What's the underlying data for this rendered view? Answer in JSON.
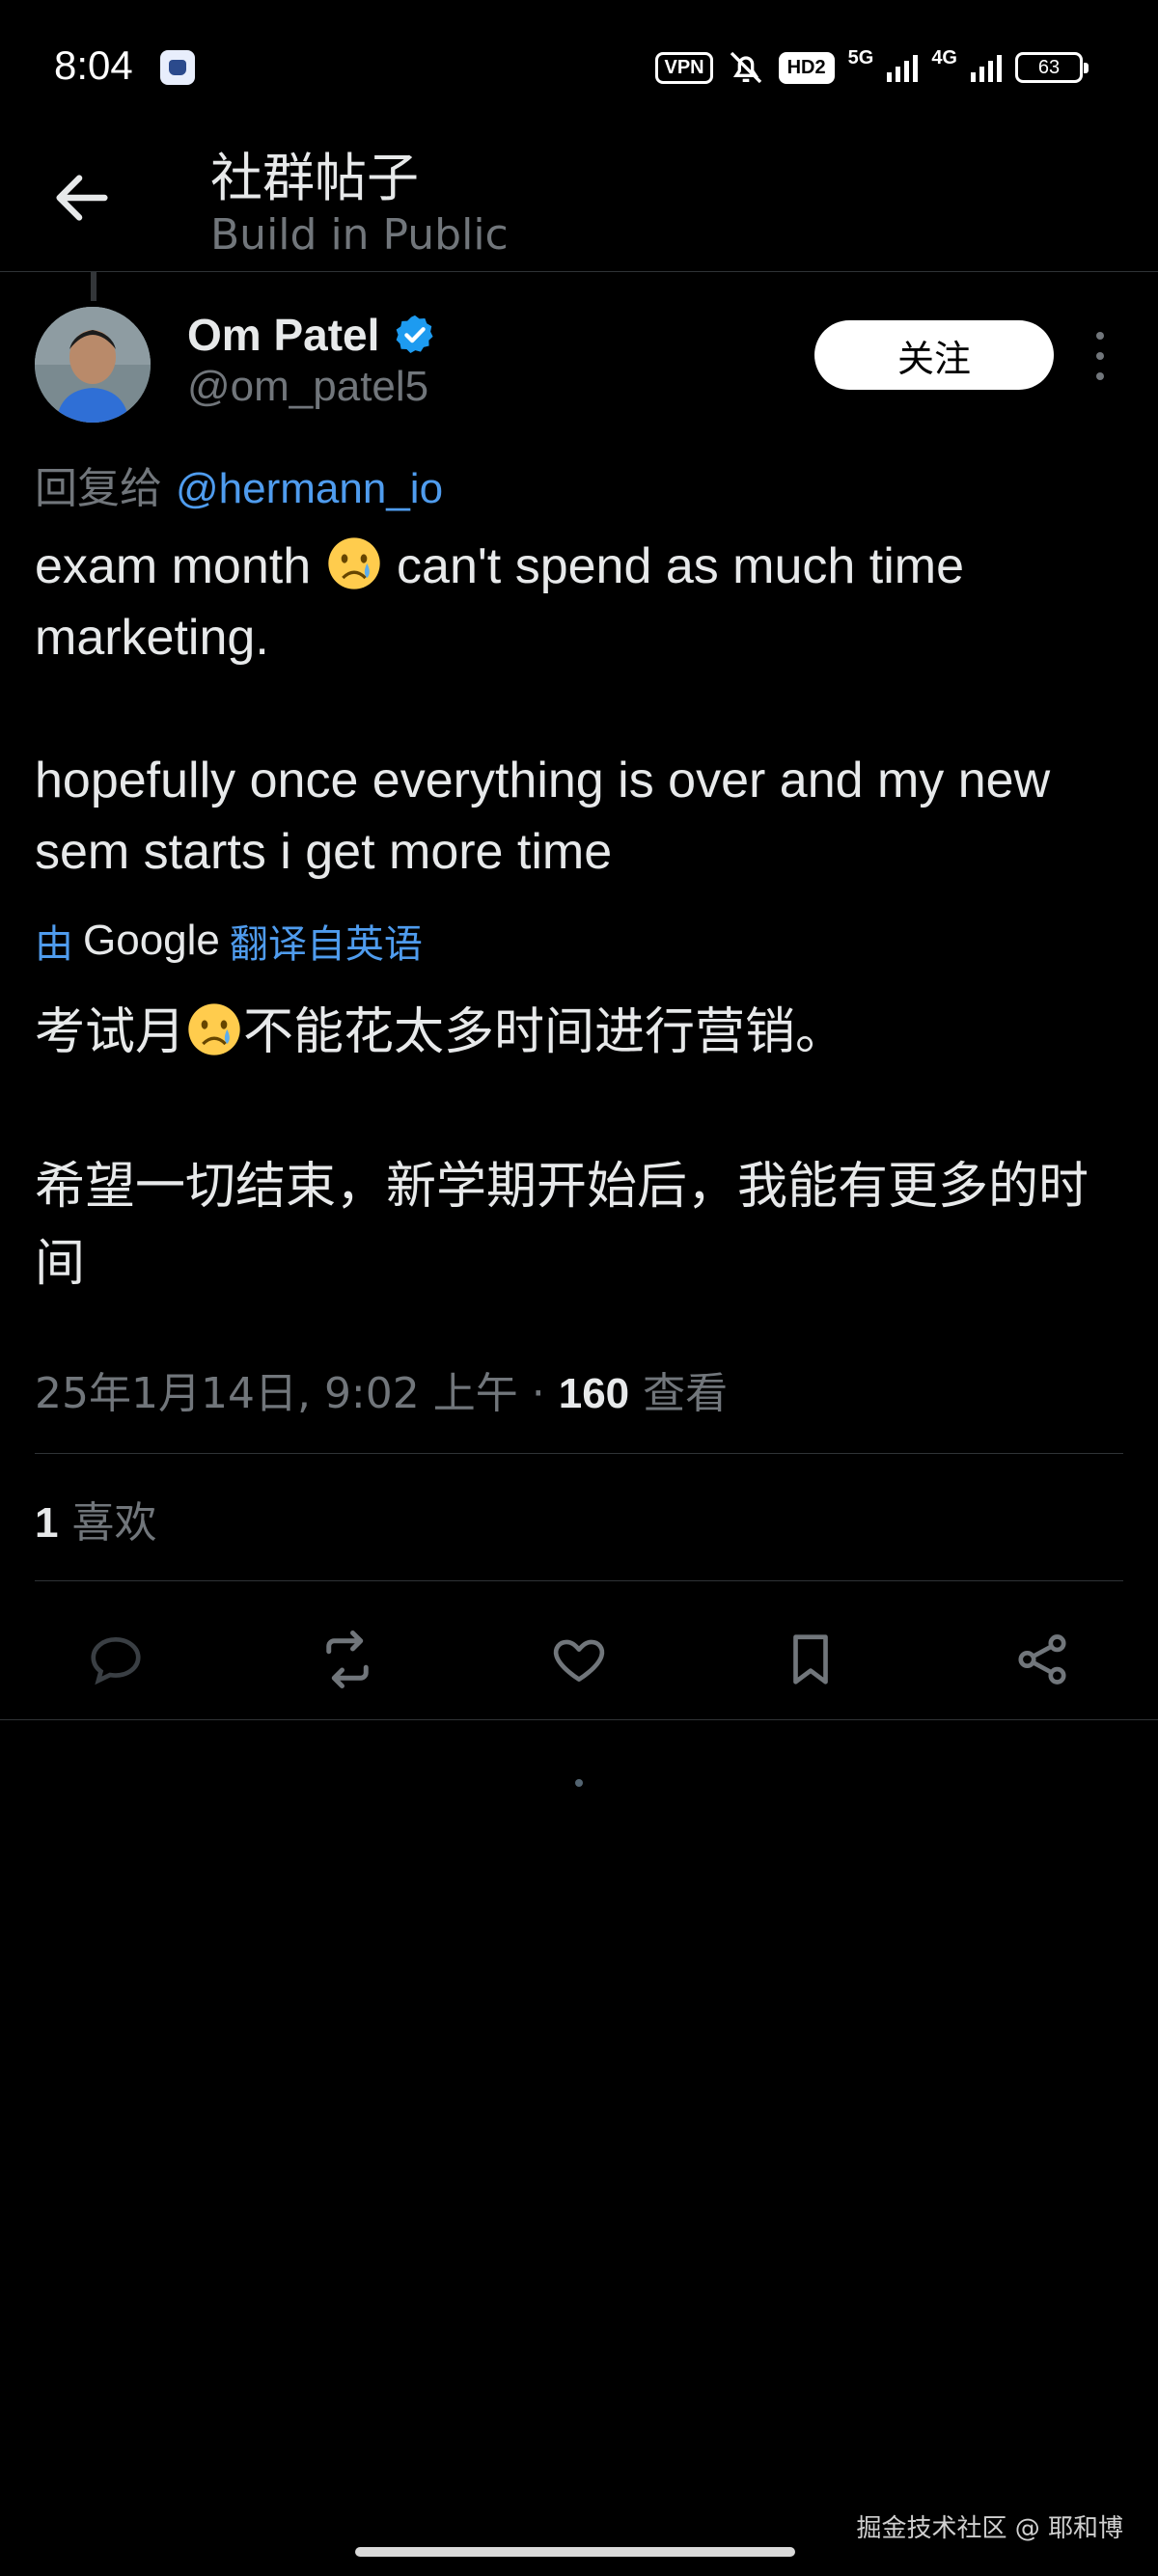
{
  "status_bar": {
    "time": "8:04",
    "vpn": "VPN",
    "hd": "HD2",
    "net1": "5G",
    "net2": "4G",
    "battery": "63"
  },
  "header": {
    "title": "社群帖子",
    "subtitle": "Build in Public"
  },
  "author": {
    "name": "Om Patel",
    "handle": "@om_patel5",
    "verified_color": "#1d9bf0"
  },
  "follow_label": "关注",
  "reply": {
    "prefix": "回复给",
    "mention": "@hermann_io"
  },
  "tweet": {
    "line1_before": "exam month ",
    "line1_after": " can't spend as much time marketing.",
    "rest": "\n\nhopefully once everything is over and my new sem starts i get more time"
  },
  "translation_note": {
    "by": "由",
    "provider": "Google",
    "action": "翻译自英语"
  },
  "translation": {
    "before": "考试月",
    "after": "不能花太多时间进行营销。\n\n希望一切结束，新学期开始后，我能有更多的时间"
  },
  "meta": {
    "timestamp": "25年1月14日, 9:02 上午",
    "separator": " · ",
    "views_count": "160",
    "views_label": " 查看"
  },
  "likes": {
    "count": "1",
    "label": " 喜欢"
  },
  "actions": {
    "icons": [
      "reply-icon",
      "retweet-icon",
      "like-icon",
      "bookmark-icon",
      "share-icon"
    ]
  },
  "watermark": "掘金技术社区 @ 耶和博",
  "colors": {
    "background": "#000000",
    "link": "#4f9cee",
    "muted": "#71767b"
  }
}
